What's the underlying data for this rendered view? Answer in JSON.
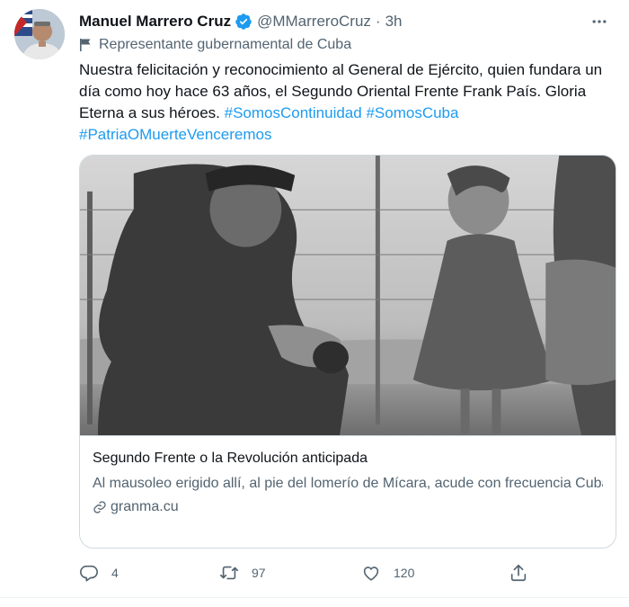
{
  "author": {
    "name": "Manuel Marrero Cruz",
    "handle": "@MMarreroCruz",
    "separator": "·",
    "time": "3h",
    "label": "Representante gubernamental de Cuba"
  },
  "text": {
    "body": "Nuestra felicitación y reconocimiento al General de Ejército, quien fundara un día como hoy hace 63 años, el Segundo Oriental Frente Frank País. Gloria Eterna a sus héroes.",
    "hashtags": [
      "#SomosContinuidad",
      "#SomosCuba",
      "#PatriaOMuerteVenceremos"
    ]
  },
  "card": {
    "title": "Segundo Frente o la Revolución anticipada",
    "description": "Al mausoleo erigido allí, al pie del lomerío de Mícara, acude con frecuencia Cuba a recordar la gesta que en aquel lugar contribuyó a ...",
    "domain": "granma.cu"
  },
  "actions": {
    "replies": "4",
    "retweets": "97",
    "likes": "120"
  },
  "colors": {
    "accent": "#1d9bf0",
    "text": "#0f1419",
    "secondary": "#536471",
    "border": "#cfd9de"
  },
  "icons": {
    "verified": "verified-badge-icon",
    "more": "more-dots-icon",
    "label": "flag-icon",
    "link": "link-icon",
    "reply": "reply-icon",
    "retweet": "retweet-icon",
    "like": "heart-icon",
    "share": "share-icon"
  }
}
